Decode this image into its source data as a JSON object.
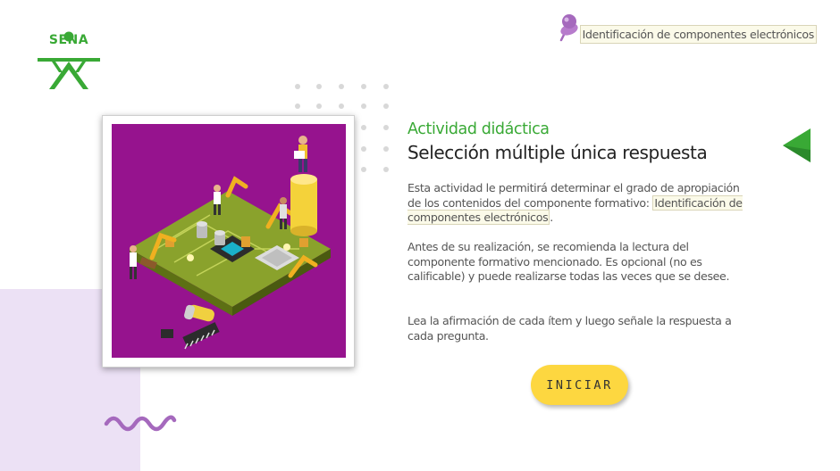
{
  "branding": {
    "logo_text": "SENA",
    "brand_green": "#39a935"
  },
  "header": {
    "title": "Identificación de componentes electrónicos",
    "pin_icon": "pushpin-icon"
  },
  "navigation": {
    "back_icon": "triangle-left-icon"
  },
  "activity": {
    "kicker": "Actividad didáctica",
    "heading": "Selección múltiple única respuesta",
    "intro_before": "Esta actividad le permitirá determinar el grado de apropiación de los contenidos del componente formativo: ",
    "intro_highlight": "Identificación de componentes electrónicos",
    "intro_after": ".",
    "recommendation": "Antes de su realización, se recomienda la lectura del componente formativo mencionado.  Es opcional (no es calificable) y puede realizarse todas las veces que se desee.",
    "instruction": "Lea la afirmación de cada ítem y luego señale la respuesta a cada pregunta."
  },
  "actions": {
    "start_label": "INICIAR",
    "start_color": "#fdd740"
  },
  "colors": {
    "accent_purple": "#a569bd",
    "lilac": "#ece1f5",
    "image_bg": "#96138e"
  }
}
